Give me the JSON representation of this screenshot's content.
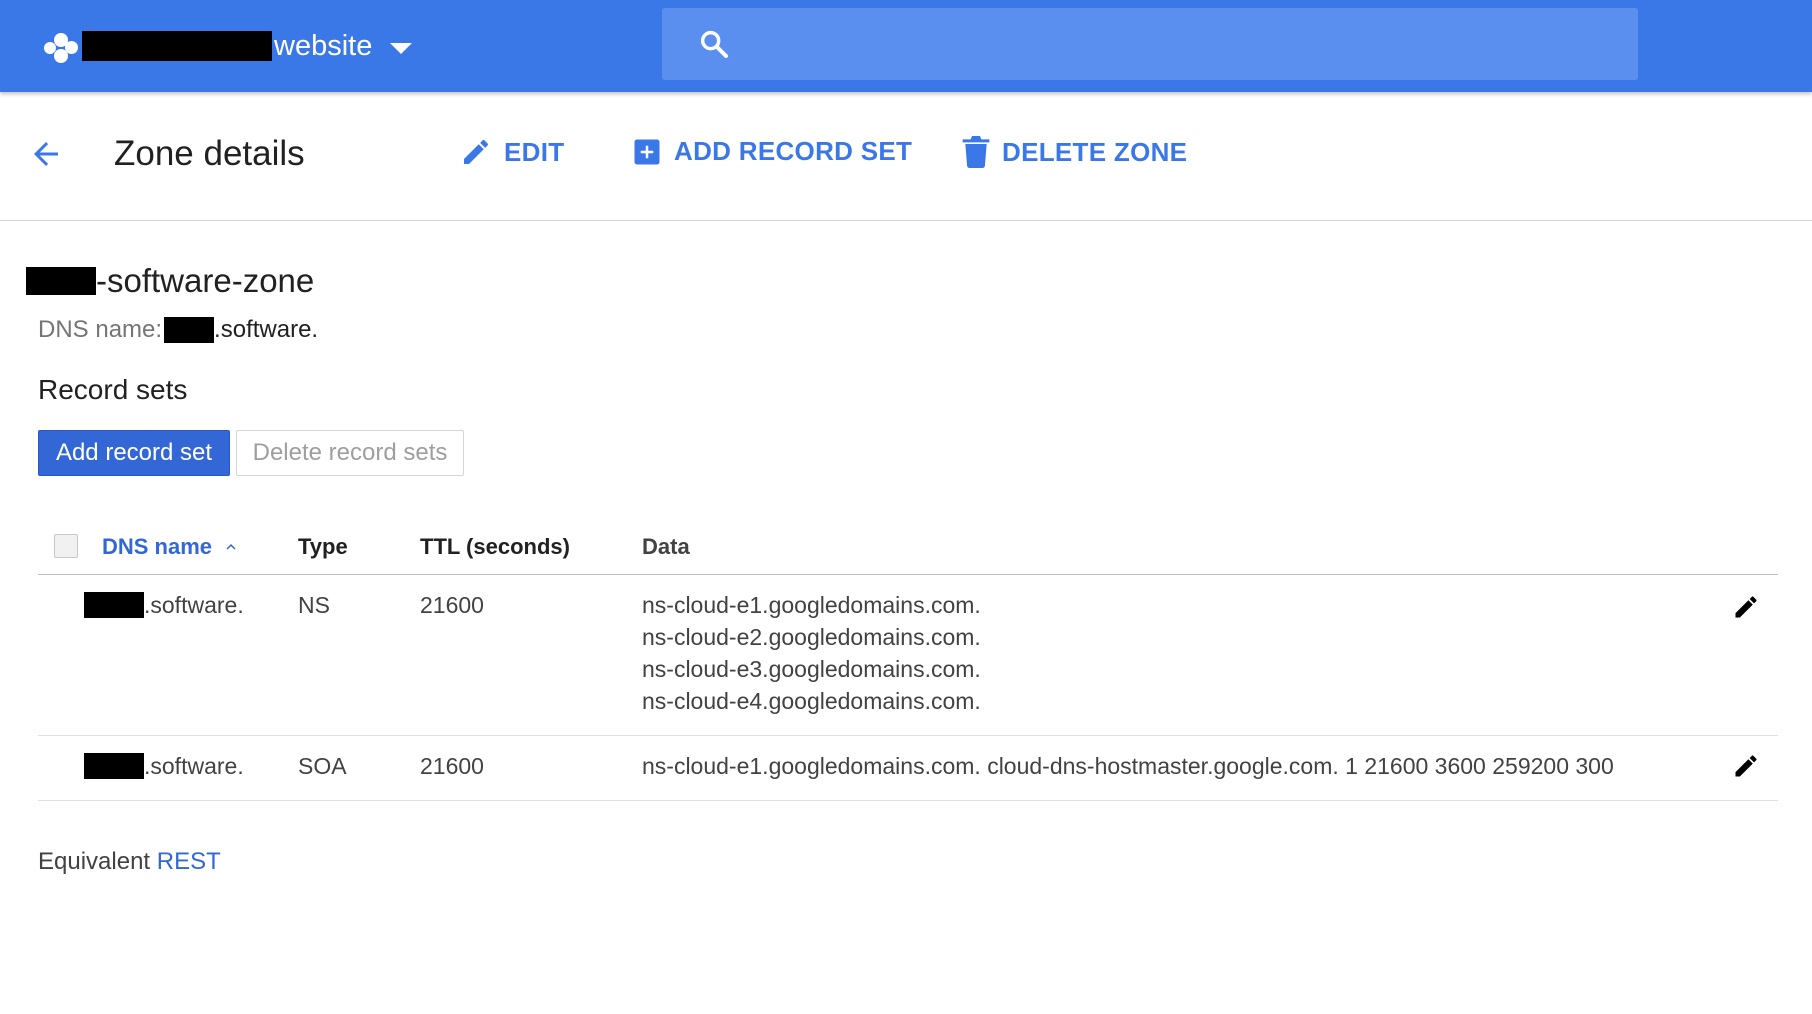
{
  "topbar": {
    "project_name": "website",
    "search": {
      "placeholder": ""
    },
    "colors": {
      "bar": "#3b78e7",
      "search_box": "#5a8ff0"
    }
  },
  "page": {
    "title": "Zone details",
    "actions": {
      "edit": "EDIT",
      "add_record_set": "ADD RECORD SET",
      "delete_zone": "DELETE ZONE"
    }
  },
  "zone": {
    "name_suffix": "-software-zone",
    "dns_label": "DNS name:",
    "dns_value": ".software."
  },
  "record_sets": {
    "title": "Record sets",
    "add_button": "Add record set",
    "delete_button": "Delete record sets",
    "columns": {
      "dns_name": "DNS name",
      "type": "Type",
      "ttl": "TTL (seconds)",
      "data": "Data"
    },
    "rows": [
      {
        "name_suffix": ".software.",
        "type": "NS",
        "ttl": "21600",
        "data": [
          "ns-cloud-e1.googledomains.com.",
          "ns-cloud-e2.googledomains.com.",
          "ns-cloud-e3.googledomains.com.",
          "ns-cloud-e4.googledomains.com."
        ]
      },
      {
        "name_suffix": ".software.",
        "type": "SOA",
        "ttl": "21600",
        "data": [
          "ns-cloud-e1.googledomains.com. cloud-dns-hostmaster.google.com. 1 21600 3600 259200 300"
        ]
      }
    ]
  },
  "footer": {
    "prefix": "Equivalent ",
    "link": "REST"
  },
  "icons": {
    "logo": "project-hexagon-icon",
    "caret": "caret-down-icon",
    "search": "search-icon",
    "back": "back-arrow-icon",
    "edit": "pencil-icon",
    "add": "add-box-icon",
    "delete": "trash-icon",
    "sort": "chevron-up-icon"
  }
}
